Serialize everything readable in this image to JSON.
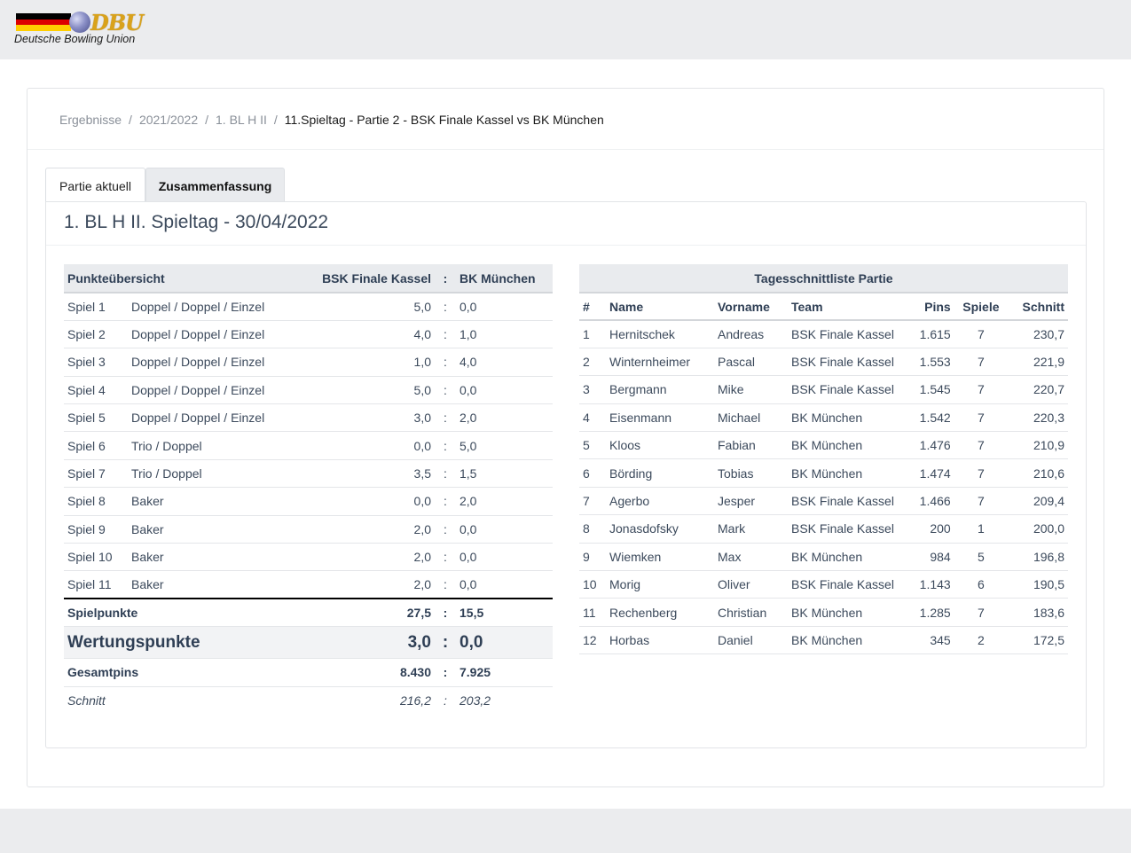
{
  "logo": {
    "mark": "DBU",
    "tagline": "Deutsche Bowling Union"
  },
  "breadcrumb": {
    "items": [
      "Ergebnisse",
      "2021/2022",
      "1. BL H II"
    ],
    "separator": "/",
    "active": "11.Spieltag - Partie 2 - BSK Finale Kassel vs BK München"
  },
  "tabs": [
    {
      "label": "Partie aktuell"
    },
    {
      "label": "Zusammenfassung"
    }
  ],
  "panel": {
    "title": "1. BL H II. Spieltag - 30/04/2022"
  },
  "points": {
    "header": {
      "title": "Punkteübersicht",
      "team_a": "BSK Finale Kassel",
      "sep": ":",
      "team_b": "BK München"
    },
    "games": [
      {
        "game": "Spiel 1",
        "format": "Doppel / Doppel / Einzel",
        "a": "5,0",
        "b": "0,0"
      },
      {
        "game": "Spiel 2",
        "format": "Doppel / Doppel / Einzel",
        "a": "4,0",
        "b": "1,0"
      },
      {
        "game": "Spiel 3",
        "format": "Doppel / Doppel / Einzel",
        "a": "1,0",
        "b": "4,0"
      },
      {
        "game": "Spiel 4",
        "format": "Doppel / Doppel / Einzel",
        "a": "5,0",
        "b": "0,0"
      },
      {
        "game": "Spiel 5",
        "format": "Doppel / Doppel / Einzel",
        "a": "3,0",
        "b": "2,0"
      },
      {
        "game": "Spiel 6",
        "format": "Trio / Doppel",
        "a": "0,0",
        "b": "5,0"
      },
      {
        "game": "Spiel 7",
        "format": "Trio / Doppel",
        "a": "3,5",
        "b": "1,5"
      },
      {
        "game": "Spiel 8",
        "format": "Baker",
        "a": "0,0",
        "b": "2,0"
      },
      {
        "game": "Spiel 9",
        "format": "Baker",
        "a": "2,0",
        "b": "0,0"
      },
      {
        "game": "Spiel 10",
        "format": "Baker",
        "a": "2,0",
        "b": "0,0"
      },
      {
        "game": "Spiel 11",
        "format": "Baker",
        "a": "2,0",
        "b": "0,0"
      }
    ],
    "sep": ":",
    "spielpunkte": {
      "label": "Spielpunkte",
      "a": "27,5",
      "b": "15,5"
    },
    "wertungspunkte": {
      "label": "Wertungspunkte",
      "a": "3,0",
      "b": "0,0"
    },
    "gesamtpins": {
      "label": "Gesamtpins",
      "a": "8.430",
      "b": "7.925"
    },
    "schnitt": {
      "label": "Schnitt",
      "a": "216,2",
      "b": "203,2"
    }
  },
  "ranking": {
    "caption": "Tagesschnittliste Partie",
    "columns": [
      "#",
      "Name",
      "Vorname",
      "Team",
      "Pins",
      "Spiele",
      "Schnitt"
    ],
    "rows": [
      [
        "1",
        "Hernitschek",
        "Andreas",
        "BSK Finale Kassel",
        "1.615",
        "7",
        "230,7"
      ],
      [
        "2",
        "Winternheimer",
        "Pascal",
        "BSK Finale Kassel",
        "1.553",
        "7",
        "221,9"
      ],
      [
        "3",
        "Bergmann",
        "Mike",
        "BSK Finale Kassel",
        "1.545",
        "7",
        "220,7"
      ],
      [
        "4",
        "Eisenmann",
        "Michael",
        "BK München",
        "1.542",
        "7",
        "220,3"
      ],
      [
        "5",
        "Kloos",
        "Fabian",
        "BK München",
        "1.476",
        "7",
        "210,9"
      ],
      [
        "6",
        "Börding",
        "Tobias",
        "BK München",
        "1.474",
        "7",
        "210,6"
      ],
      [
        "7",
        "Agerbo",
        "Jesper",
        "BSK Finale Kassel",
        "1.466",
        "7",
        "209,4"
      ],
      [
        "8",
        "Jonasdofsky",
        "Mark",
        "BSK Finale Kassel",
        "200",
        "1",
        "200,0"
      ],
      [
        "9",
        "Wiemken",
        "Max",
        "BK München",
        "984",
        "5",
        "196,8"
      ],
      [
        "10",
        "Morig",
        "Oliver",
        "BSK Finale Kassel",
        "1.143",
        "6",
        "190,5"
      ],
      [
        "11",
        "Rechenberg",
        "Christian",
        "BK München",
        "1.285",
        "7",
        "183,6"
      ],
      [
        "12",
        "Horbas",
        "Daniel",
        "BK München",
        "345",
        "2",
        "172,5"
      ]
    ]
  },
  "colors": {
    "flag_black": "#000000",
    "flag_red": "#dd0000",
    "flag_gold": "#ffce00",
    "logo_gold": "#d9a21b",
    "text": "#3c4a5c",
    "header_bg": "#e9ebee"
  }
}
